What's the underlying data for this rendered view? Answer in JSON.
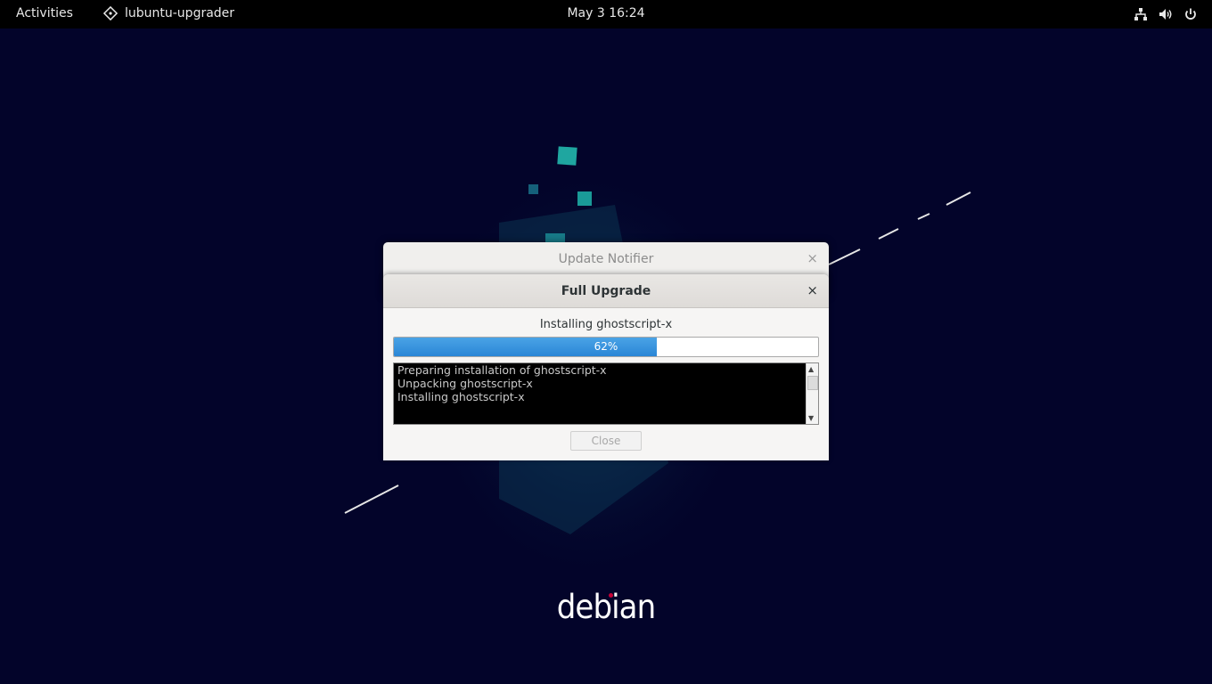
{
  "topbar": {
    "activities": "Activities",
    "app_name": "lubuntu-upgrader",
    "clock": "May 3  16:24",
    "tray_icons": [
      "network-icon",
      "volume-icon",
      "power-icon"
    ]
  },
  "back_dialog": {
    "title": "Update Notifier",
    "close": "×"
  },
  "dialog": {
    "title": "Full Upgrade",
    "close": "×",
    "status": "Installing ghostscript-x",
    "progress": {
      "value": 62,
      "label": "62%"
    },
    "log_lines": [
      "Preparing installation of ghostscript-x",
      "Unpacking ghostscript-x",
      "Installing ghostscript-x"
    ],
    "close_button": "Close"
  },
  "wallpaper": {
    "logo_text": "debian"
  },
  "colors": {
    "desktop_bg": "#03042a",
    "accent_progress": "#2a86d6",
    "debian_red": "#c70036"
  }
}
